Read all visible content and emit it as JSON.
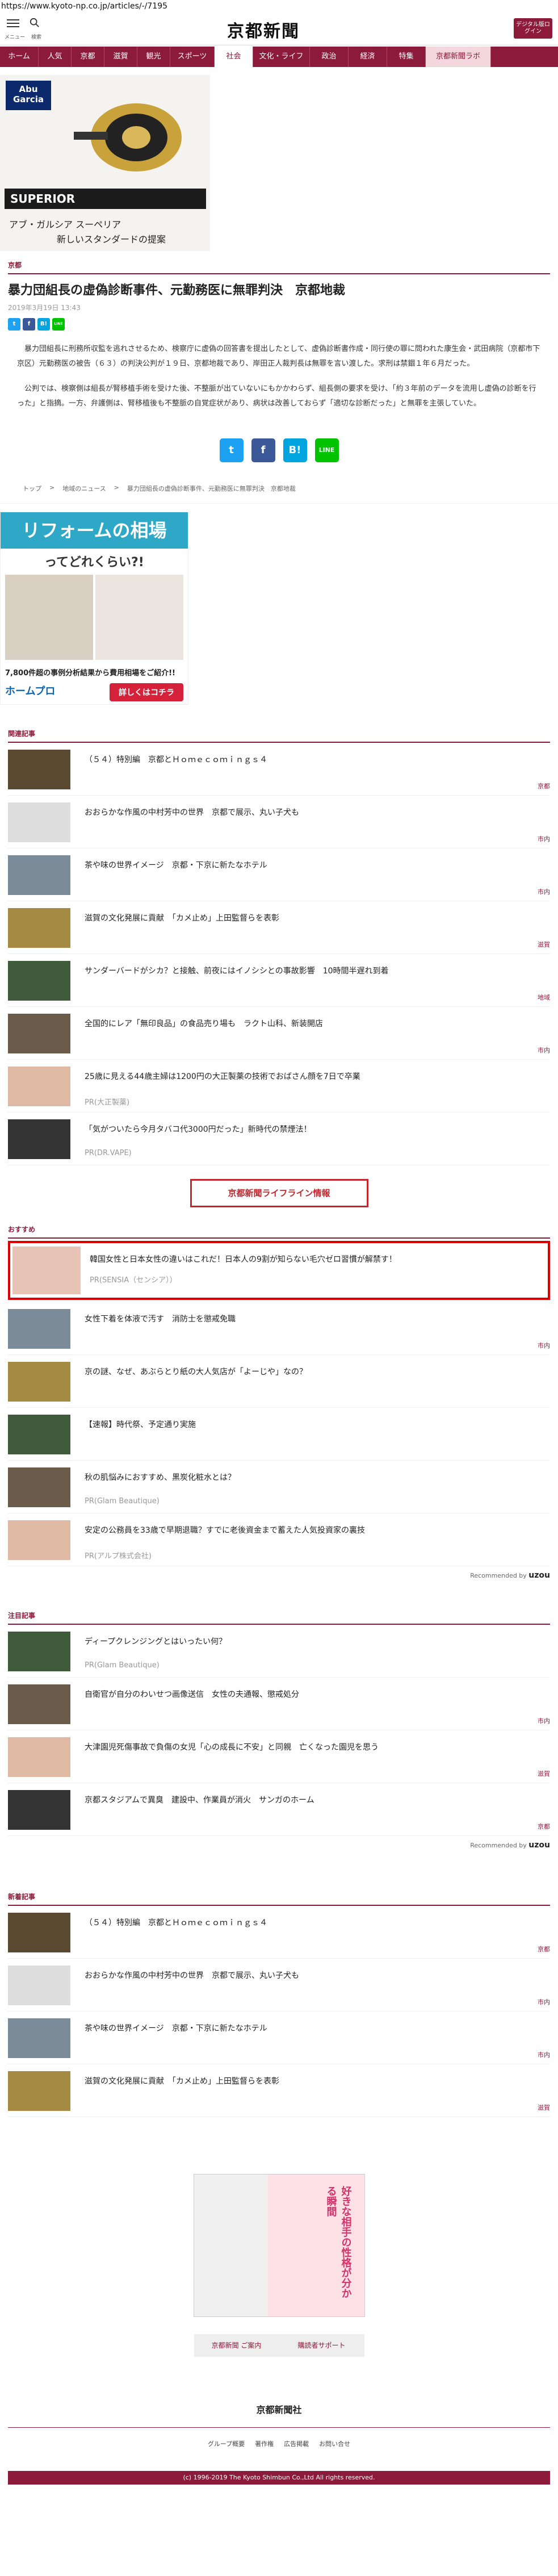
{
  "browser": {
    "url": "https://www.kyoto-np.co.jp/articles/-/7195"
  },
  "header": {
    "menu_label": "メニュー",
    "search_label": "検索",
    "logo": "京都新聞",
    "digital_btn": "デジタル版ログイン"
  },
  "nav": [
    "ホーム",
    "人気",
    "京都",
    "滋賀",
    "観光",
    "スポーツ",
    "社会",
    "文化・ライフ",
    "政治",
    "経済",
    "特集",
    "京都新聞ラボ"
  ],
  "ad_top": {
    "brand": "Abu Garcia",
    "product": "SUPERIOR",
    "copy1": "アブ・ガルシア スーペリア",
    "copy2": "新しいスタンダードの提案"
  },
  "article": {
    "category": "京都",
    "title": "暴力団組長の虚偽診断事件、元勤務医に無罪判決　京都地裁",
    "date": "2019年3月19日 13:43",
    "paragraphs": [
      "暴力団組長に刑務所収監を逃れさせるため、検察庁に虚偽の回答書を提出したとして、虚偽診断書作成・同行使の罪に問われた康生会・武田病院（京都市下京区）元勤務医の被告（６３）の判決公判が１９日、京都地裁であり、岸田正人裁判長は無罪を言い渡した。求刑は禁錮１年６月だった。",
      "公判では、検察側は組長が腎移植手術を受けた後、不整脈が出ていないにもかかわらず、組長側の要求を受け、「約３年前のデータを流用し虚偽の診断を行った」と指摘。一方、弁護側は、腎移植後も不整脈の自覚症状があり、病状は改善しておらず「適切な診断だった」と無罪を主張していた。"
    ]
  },
  "share": {
    "twitter": "t",
    "facebook": "f",
    "hatena": "B!",
    "line": "LINE"
  },
  "breadcrumbs": [
    "トップ",
    "地域のニュース",
    "暴力団組長の虚偽診断事件、元勤務医に無罪判決　京都地裁"
  ],
  "ad_mid": {
    "headline": "リフォームの相場",
    "sub": "ってどれくらい?!",
    "stat": "7,800件超の事例分析結果から費用相場をご紹介!!",
    "brand": "ホームプロ",
    "cta": "詳しくはコチラ"
  },
  "related": {
    "heading": "関連記事",
    "items": [
      {
        "title": "（５４）特別編　京都とＨｏｍｅｃｏｍｉｎｇｓ４",
        "cat": "京都"
      },
      {
        "title": "おおらかな作風の中村芳中の世界　京都で展示、丸い子犬も",
        "cat": "市内"
      },
      {
        "title": "茶や味の世界イメージ　京都・下京に新たなホテル",
        "cat": "市内"
      },
      {
        "title": "滋賀の文化発展に貢献　「カメ止め」上田監督らを表彰",
        "cat": "滋賀"
      },
      {
        "title": "サンダーバードがシカ？と接触、前夜にはイノシシとの事故影響　10時間半遅れ到着",
        "cat": "地域"
      },
      {
        "title": "全国的にレア「無印良品」の食品売り場も　ラクト山科、新装開店",
        "cat": "市内"
      },
      {
        "title": "25歳に見える44歳主婦は1200円の大正製薬の技術でおばさん顔を7日で卒業",
        "pr": "PR(大正製薬)"
      },
      {
        "title": "「気がついたら今月タバコ代3000円だった」新時代の禁煙法！",
        "pr": "PR(DR.VAPE)"
      }
    ]
  },
  "lifeline": "京都新聞ライフライン情報",
  "recommend": {
    "heading": "おすすめ",
    "items": [
      {
        "title": "韓国女性と日本女性の違いはこれだ！日本人の9割が知らない毛穴ゼロ習慣が解禁す！",
        "pr": "PR(SENSIA（センシア））"
      },
      {
        "title": "女性下着を体液で汚す　消防士を懲戒免職",
        "cat": "市内"
      },
      {
        "title": "京の謎、なぜ、あぶらとり紙の大人気店が「よーじや」なの？"
      },
      {
        "title": "【速報】時代祭、予定通り実施"
      },
      {
        "title": "秋の肌悩みにおすすめ、黒炭化粧水とは？",
        "pr": "PR(Glam Beautique)"
      },
      {
        "title": "安定の公務員を33歳で早期退職？すでに老後資金まで蓄えた人気投資家の裏技",
        "pr": "PR(アルプ株式会社)"
      }
    ],
    "by": "Recommended by",
    "by_brand": "uzou"
  },
  "attention": {
    "heading": "注目記事",
    "items": [
      {
        "title": "ディープクレンジングとはいったい何？",
        "pr": "PR(Glam Beautique)"
      },
      {
        "title": "自衛官が自分のわいせつ画像送信　女性の夫通報、懲戒処分",
        "cat": "市内"
      },
      {
        "title": "大津園児死傷事故で負傷の女児「心の成長に不安」と同親　亡くなった園児を思う",
        "cat": "滋賀"
      },
      {
        "title": "京都スタジアムで異臭　建設中、作業員が消火　サンガのホーム",
        "cat": "京都"
      }
    ],
    "by": "Recommended by",
    "by_brand": "uzou"
  },
  "latest": {
    "heading": "新着記事",
    "items": [
      {
        "title": "（５４）特別編　京都とＨｏｍｅｃｏｍｉｎｇｓ４",
        "cat": "京都"
      },
      {
        "title": "おおらかな作風の中村芳中の世界　京都で展示、丸い子犬も",
        "cat": "市内"
      },
      {
        "title": "茶や味の世界イメージ　京都・下京に新たなホテル",
        "cat": "市内"
      },
      {
        "title": "滋賀の文化発展に貢献　「カメ止め」上田監督らを表彰",
        "cat": "滋賀"
      }
    ]
  },
  "bottom_ad": {
    "text": "好きな相手の性格が分かる瞬間"
  },
  "footer_btns": [
    "京都新聞 ご案内",
    "購読者サポート"
  ],
  "footer_logo": "京都新聞社",
  "footer_links": [
    "グループ概要",
    "著作権",
    "広告掲載",
    "お問い合せ"
  ],
  "copyright": "(c) 1996-2019 The Kyoto Shimbun Co.,Ltd All rights reserved."
}
